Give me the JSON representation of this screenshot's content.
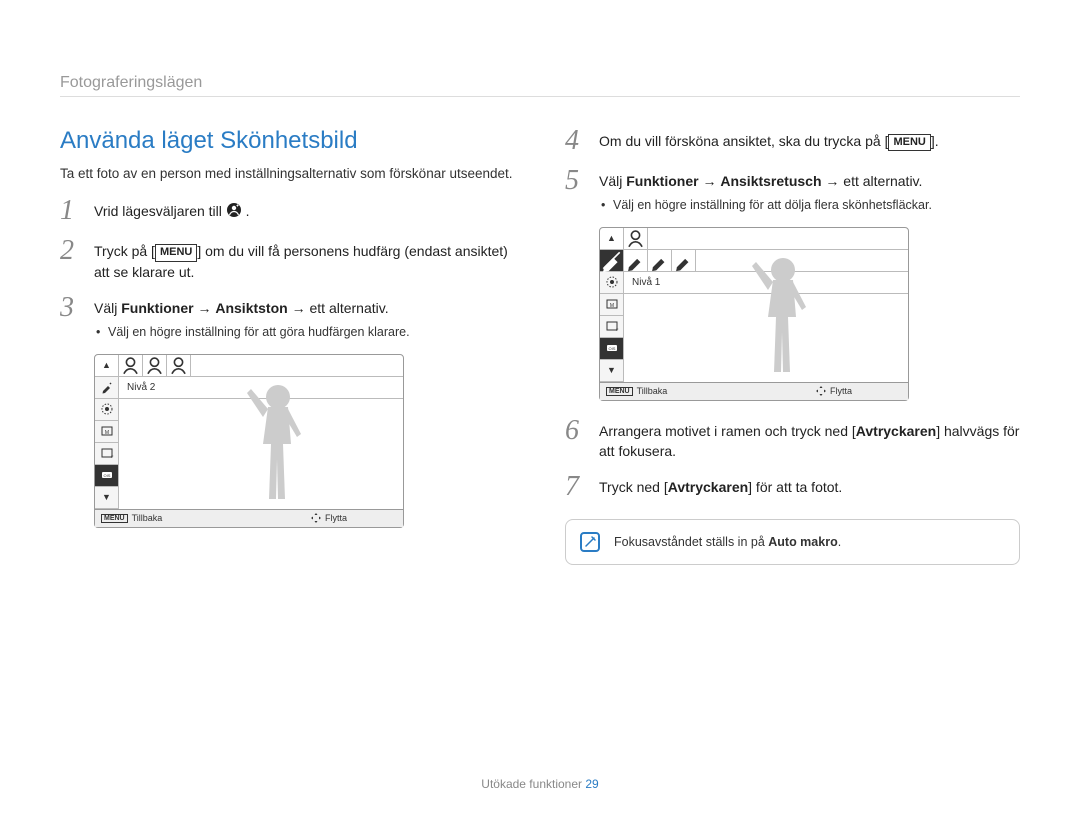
{
  "breadcrumb": "Fotograferingslägen",
  "title": "Använda läget Skönhetsbild",
  "intro": "Ta ett foto av en person med inställningsalternativ som förskönar utseendet.",
  "steps_left": [
    {
      "num": "1",
      "text_pre": "Vrid lägesväljaren till ",
      "has_mode_icon": true,
      "text_post": "."
    },
    {
      "num": "2",
      "text_pre": "Tryck på [",
      "has_menu": true,
      "text_post": "] om du vill få personens hudfärg (endast ansiktet) att se klarare ut."
    },
    {
      "num": "3",
      "text_pre": "Välj ",
      "bold1": "Funktioner",
      "arrow1": " → ",
      "bold2": "Ansiktston",
      "arrow2": " → ",
      "text_post": "ett alternativ.",
      "bullet": "Välj en högre inställning för att göra hudfärgen klarare."
    }
  ],
  "steps_right": [
    {
      "num": "4",
      "text_pre": "Om du vill försköna ansiktet, ska du trycka på [",
      "has_menu": true,
      "text_post": "]."
    },
    {
      "num": "5",
      "text_pre": "Välj ",
      "bold1": "Funktioner",
      "arrow1": " → ",
      "bold2": "Ansiktsretusch",
      "arrow2": " → ",
      "text_post": "ett alternativ.",
      "bullet": "Välj en högre inställning för att dölja flera skönhetsfläckar."
    },
    {
      "num": "6",
      "text_pre": "Arrangera motivet i ramen och tryck ned [",
      "bold1": "Avtryckaren",
      "text_post": "] halvvägs för att fokusera."
    },
    {
      "num": "7",
      "text_pre": "Tryck ned [",
      "bold1": "Avtryckaren",
      "text_post": "] för att ta fotot."
    }
  ],
  "camera_left": {
    "niva_label": "Nivå 2",
    "footer_back": "Tillbaka",
    "footer_move": "Flytta",
    "footer_menu": "MENU"
  },
  "camera_right": {
    "niva_label": "Nivå 1",
    "footer_back": "Tillbaka",
    "footer_move": "Flytta",
    "footer_menu": "MENU"
  },
  "note": {
    "text_pre": "Fokusavståndet ställs in på ",
    "bold": "Auto makro",
    "text_post": "."
  },
  "footer": {
    "section": "Utökade funktioner",
    "page": "29"
  },
  "menu_label": "MENU"
}
